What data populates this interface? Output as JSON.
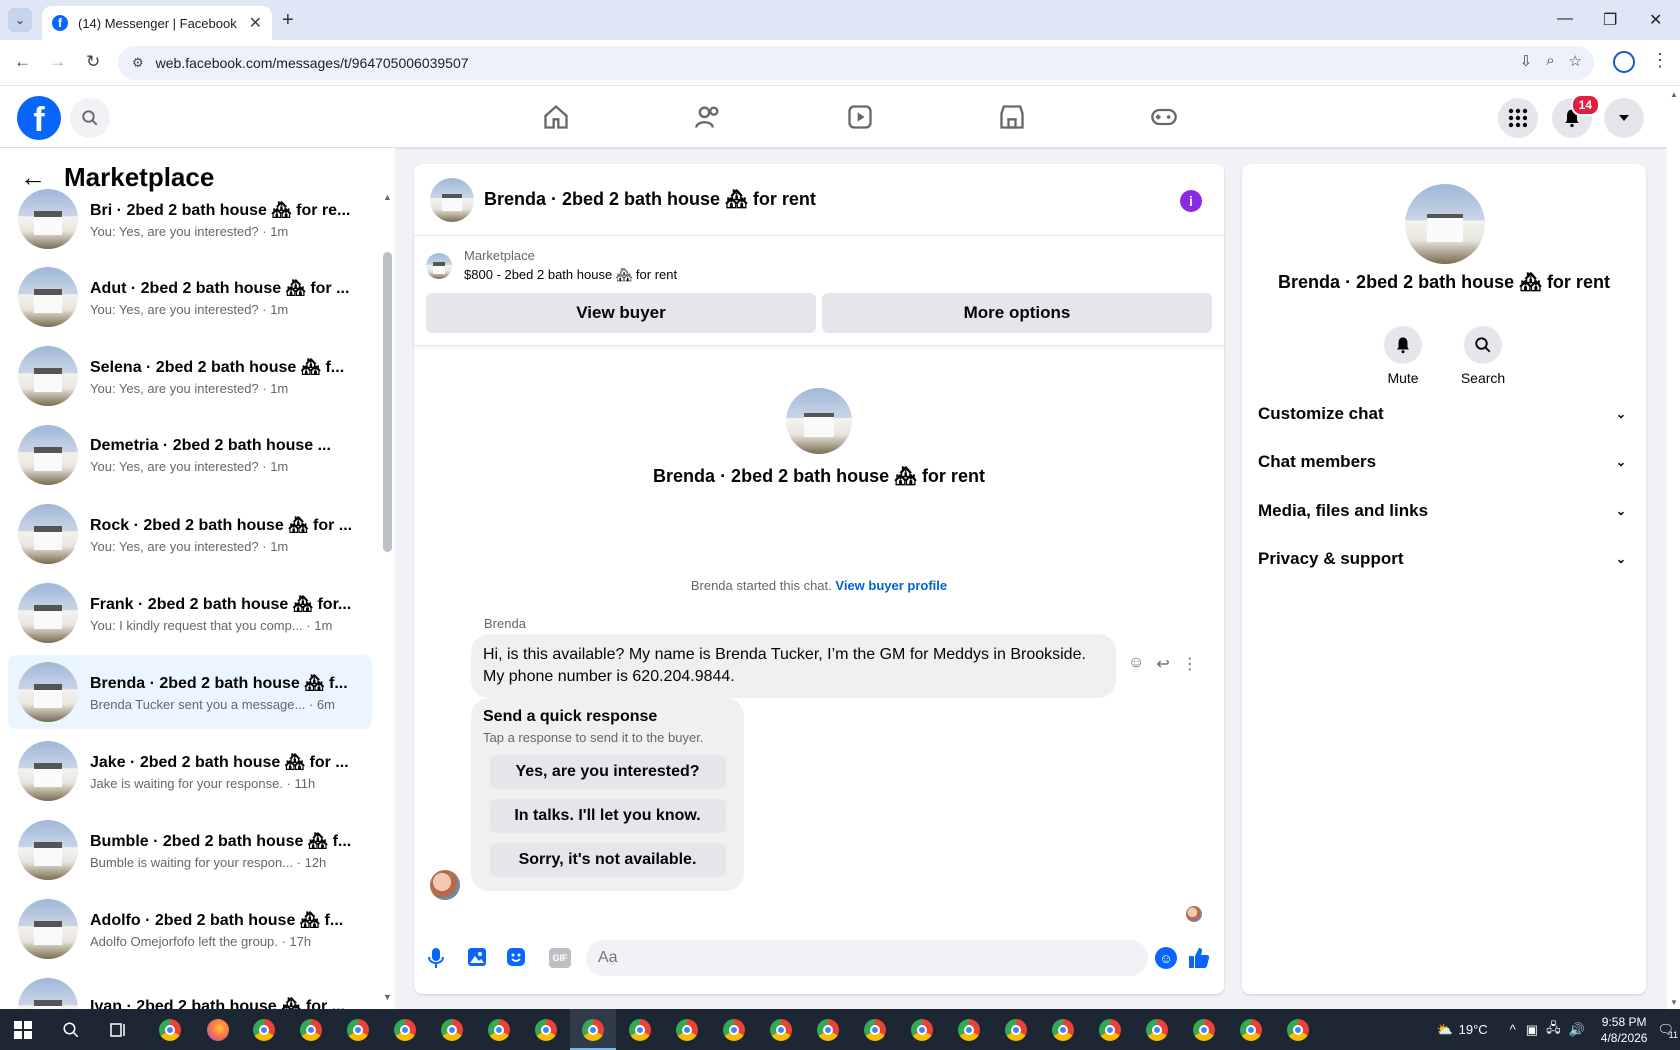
{
  "browser": {
    "tab_title": "(14) Messenger | Facebook",
    "url": "web.facebook.com/messages/t/964705006039507"
  },
  "fb": {
    "notification_count": "14"
  },
  "left": {
    "title": "Marketplace",
    "conversations": [
      {
        "name": "Bri · 2bed 2 bath house 🏘 for re...",
        "sub": "You: Yes, are you interested? · 1m"
      },
      {
        "name": "Adut · 2bed 2 bath house 🏘 for ...",
        "sub": "You: Yes, are you interested? · 1m"
      },
      {
        "name": "Selena · 2bed 2 bath house 🏘 f...",
        "sub": "You: Yes, are you interested? · 1m"
      },
      {
        "name": "Demetria · 2bed 2 bath house ...",
        "sub": "You: Yes, are you interested? · 1m"
      },
      {
        "name": "Rock · 2bed 2 bath house 🏘 for ...",
        "sub": "You: Yes, are you interested? · 1m"
      },
      {
        "name": "Frank · 2bed 2 bath house 🏘 for...",
        "sub": "You: I kindly request that you comp... · 1m"
      },
      {
        "name": "Brenda · 2bed 2 bath house 🏘 f...",
        "sub": "Brenda Tucker sent you a message... · 6m"
      },
      {
        "name": "Jake · 2bed 2 bath house 🏘 for ...",
        "sub": "Jake is waiting for your response. · 11h"
      },
      {
        "name": "Bumble · 2bed 2 bath house 🏘 f...",
        "sub": "Bumble is waiting for your respon... · 12h"
      },
      {
        "name": "Adolfo · 2bed 2 bath house 🏘 f...",
        "sub": "Adolfo Omejorfofo left the group. · 17h"
      },
      {
        "name": "Ivan · 2bed 2 bath house 🏘 for ...",
        "sub": ""
      }
    ]
  },
  "chat": {
    "title": "Brenda · 2bed 2 bath house 🏘 for rent",
    "marketplace_label": "Marketplace",
    "listing": "$800 - 2bed 2 bath house 🏘 for rent",
    "view_buyer": "View buyer",
    "more_options": "More options",
    "intro_name": "Brenda · 2bed 2 bath house 🏘 for rent",
    "started_text": "Brenda started this chat.",
    "view_buyer_profile": "View buyer profile",
    "sender": "Brenda",
    "message": "Hi, is this available? My name is Brenda Tucker, I’m the GM for Meddys in Brookside. My phone number is 620.204.9844.",
    "quick_title": "Send a quick response",
    "quick_sub": "Tap a response to send it to the buyer.",
    "quick_options": [
      "Yes, are you interested?",
      "In talks. I'll let you know.",
      "Sorry, it's not available."
    ],
    "input_placeholder": "Aa",
    "gif_label": "GIF"
  },
  "right": {
    "name": "Brenda · 2bed 2 bath house 🏘 for rent",
    "mute": "Mute",
    "search": "Search",
    "sections": [
      "Customize chat",
      "Chat members",
      "Media, files and links",
      "Privacy & support"
    ]
  },
  "taskbar": {
    "temp": "19°C",
    "time": "9:58 PM",
    "date": "4/8/2026",
    "notif": "11"
  }
}
